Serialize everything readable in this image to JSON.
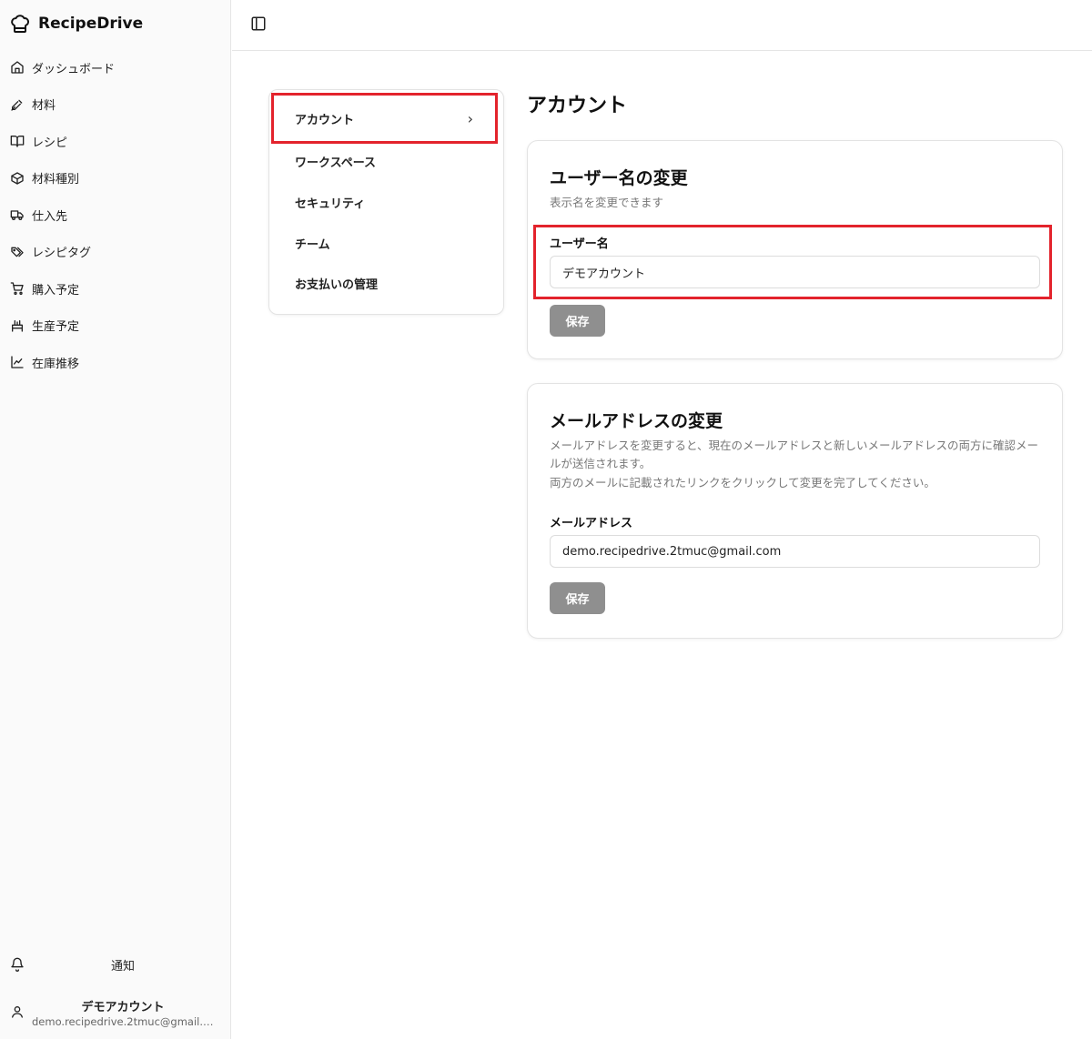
{
  "app": {
    "name": "RecipeDrive"
  },
  "sidebar": {
    "items": [
      {
        "label": "ダッシュボード",
        "icon": "home-icon"
      },
      {
        "label": "材料",
        "icon": "pen-icon"
      },
      {
        "label": "レシピ",
        "icon": "book-icon"
      },
      {
        "label": "材料種別",
        "icon": "box-icon"
      },
      {
        "label": "仕入先",
        "icon": "truck-icon"
      },
      {
        "label": "レシピタグ",
        "icon": "tags-icon"
      },
      {
        "label": "購入予定",
        "icon": "cart-icon"
      },
      {
        "label": "生産予定",
        "icon": "production-icon"
      },
      {
        "label": "在庫推移",
        "icon": "line-chart-icon"
      }
    ],
    "notifications_label": "通知",
    "user": {
      "name": "デモアカウント",
      "email": "demo.recipedrive.2tmuc@gmail.c..."
    }
  },
  "settings_menu": {
    "items": [
      {
        "label": "アカウント",
        "active": true
      },
      {
        "label": "ワークスペース"
      },
      {
        "label": "セキュリティ"
      },
      {
        "label": "チーム"
      },
      {
        "label": "お支払いの管理"
      }
    ],
    "chevron": "›"
  },
  "main": {
    "title": "アカウント",
    "username_card": {
      "title": "ユーザー名の変更",
      "description": "表示名を変更できます",
      "field_label": "ユーザー名",
      "value": "デモアカウント",
      "save_label": "保存"
    },
    "email_card": {
      "title": "メールアドレスの変更",
      "description_line1": "メールアドレスを変更すると、現在のメールアドレスと新しいメールアドレスの両方に確認メールが送信されます。",
      "description_line2": "両方のメールに記載されたリンクをクリックして変更を完了してください。",
      "field_label": "メールアドレス",
      "value": "demo.recipedrive.2tmuc@gmail.com",
      "save_label": "保存"
    }
  },
  "colors": {
    "highlight": "#e3232c",
    "button_disabled": "#8f8f8f"
  }
}
